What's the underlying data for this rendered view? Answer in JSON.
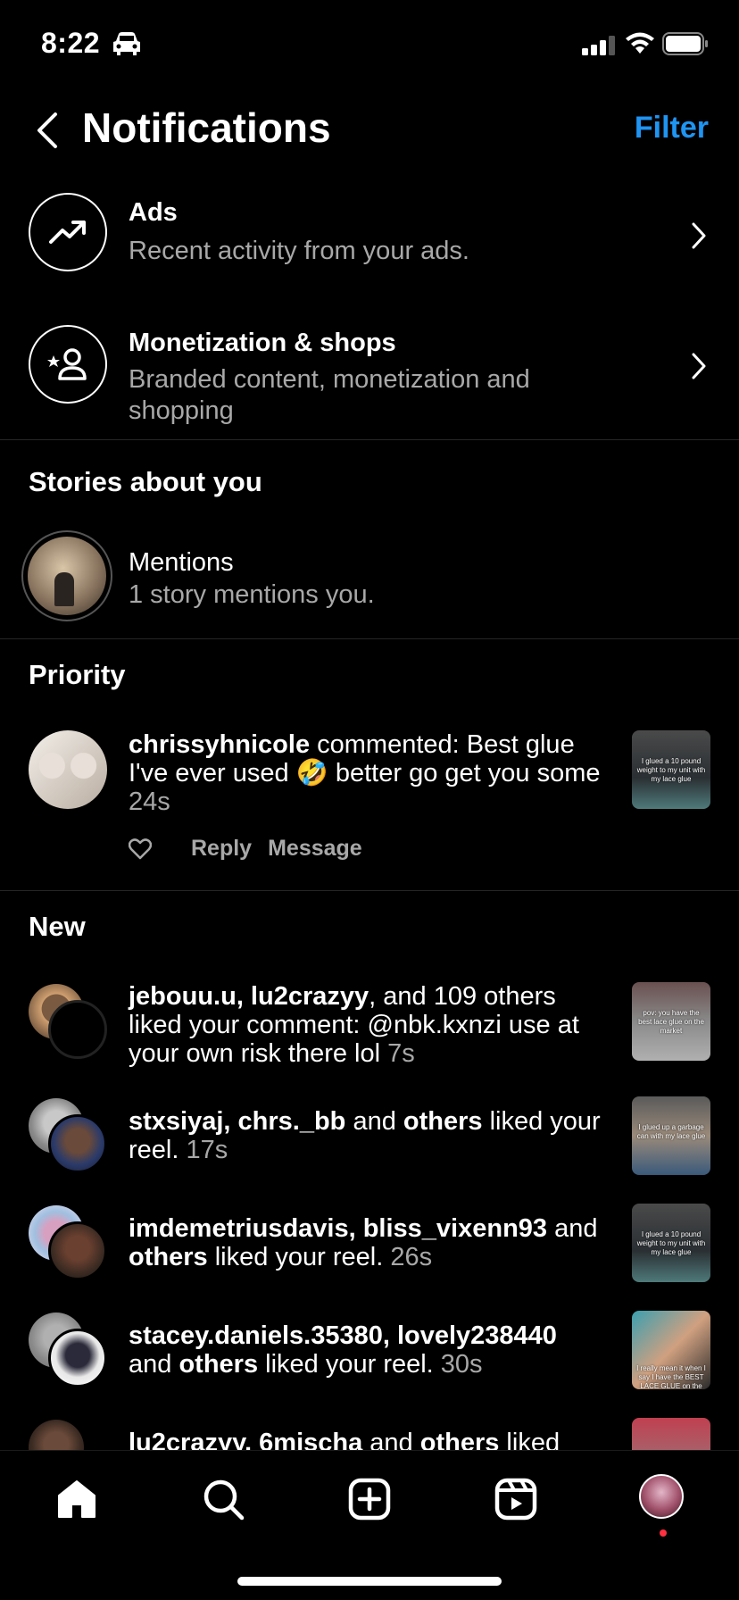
{
  "status_bar": {
    "time": "8:22"
  },
  "header": {
    "title": "Notifications",
    "filter_label": "Filter"
  },
  "categories": [
    {
      "title": "Ads",
      "subtitle": "Recent activity from your ads.",
      "icon": "trending-up-icon"
    },
    {
      "title": "Monetization & shops",
      "subtitle": "Branded content, monetization and shopping",
      "icon": "star-person-icon"
    }
  ],
  "stories_section": {
    "title": "Stories about you",
    "mentions_title": "Mentions",
    "mentions_subtitle": "1 story mentions you."
  },
  "priority_section": {
    "title": "Priority",
    "item": {
      "username": "chrissyhnicole",
      "text": " commented: Best glue I've ever used 🤣 better go get you some ",
      "time": "24s",
      "reply_label": "Reply",
      "message_label": "Message",
      "thumb_caption": "I glued a 10 pound weight to my unit with my lace glue"
    }
  },
  "new_section": {
    "title": "New",
    "items": [
      {
        "bold1": "jebouu.u, lu2crazyy",
        "mid": ", and 109 others liked your comment: @nbk.kxnzi use at your own risk there lol ",
        "time": "7s",
        "thumb_caption": "pov: you have the best lace glue on the market"
      },
      {
        "bold1": "stxsiyaj, chrs._bb",
        "mid": " and ",
        "bold2": "others",
        "tail": " liked your reel. ",
        "time": "17s",
        "thumb_caption": "I glued up a garbage can with my lace glue"
      },
      {
        "bold1": "imdemetriusdavis, bliss_vixenn93",
        "mid": " and ",
        "bold2": "others",
        "tail": " liked your reel. ",
        "time": "26s",
        "thumb_caption": "I glued a 10 pound weight to my unit with my lace glue"
      },
      {
        "bold1": "stacey.daniels.35380, lovely238440",
        "mid": " and ",
        "bold2": "others",
        "tail": " liked your reel. ",
        "time": "30s",
        "thumb_caption": "I really mean it when I say I have the BEST LACE GLUE on the"
      },
      {
        "bold1": "lu2crazyy, 6mischa",
        "mid": " and ",
        "bold2": "others",
        "tail": " liked"
      }
    ]
  },
  "tab_bar": {
    "tabs": [
      "home-icon",
      "search-icon",
      "create-icon",
      "reels-icon",
      "profile-avatar"
    ]
  },
  "colors": {
    "accent": "#1f94f2",
    "secondary_text": "#a8a8a8",
    "background": "#000000",
    "notification_dot": "#ff3040"
  }
}
